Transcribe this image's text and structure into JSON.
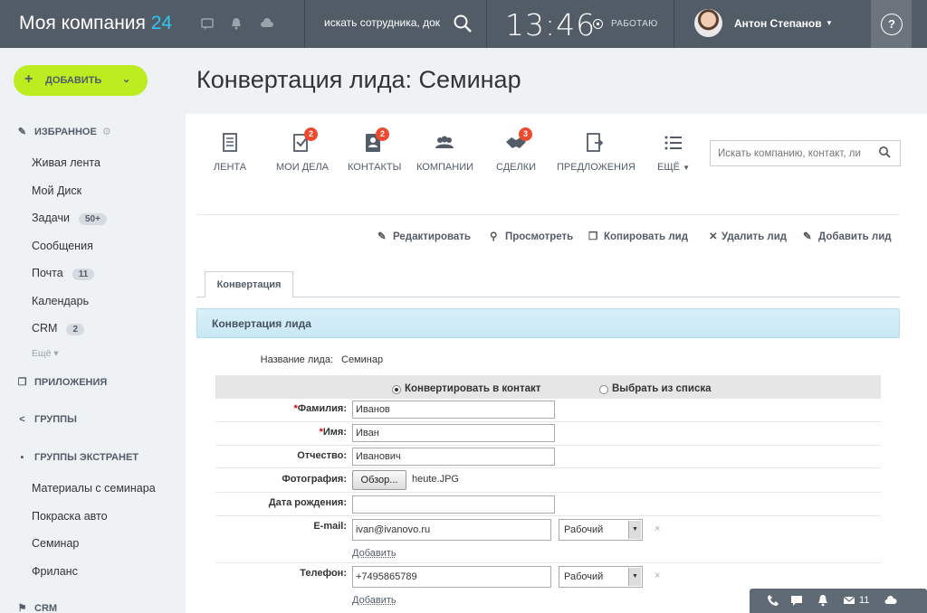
{
  "header": {
    "logo_text": "Моя компания",
    "logo_number": "24",
    "search_placeholder": "искать сотрудника, док",
    "clock": "13:46",
    "status": "РАБОТАЮ",
    "user_name": "Антон Степанов",
    "help": "?"
  },
  "sidebar": {
    "add_button": "ДОБАВИТЬ",
    "favorites_title": "ИЗБРАННОЕ",
    "favorites": [
      {
        "label": "Живая лента"
      },
      {
        "label": "Мой Диск"
      },
      {
        "label": "Задачи",
        "badge": "50+"
      },
      {
        "label": "Сообщения"
      },
      {
        "label": "Почта",
        "badge": "11"
      },
      {
        "label": "Календарь"
      },
      {
        "label": "CRM",
        "badge": "2"
      }
    ],
    "more": "Ещё",
    "apps_title": "ПРИЛОЖЕНИЯ",
    "groups_title": "ГРУППЫ",
    "extranet_title": "ГРУППЫ ЭКСТРАНЕТ",
    "extranet": [
      {
        "label": "Материалы с семинара"
      },
      {
        "label": "Покраска авто"
      },
      {
        "label": "Семинар"
      },
      {
        "label": "Фриланс"
      }
    ],
    "crm_title": "CRM"
  },
  "page_title": "Конвертация лида: Семинар",
  "crm_menu": {
    "items": [
      {
        "label": "ЛЕНТА",
        "icon": "feed-icon"
      },
      {
        "label": "МОИ ДЕЛА",
        "icon": "tasks-icon",
        "count": "2"
      },
      {
        "label": "КОНТАКТЫ",
        "icon": "contacts-icon",
        "count": "2"
      },
      {
        "label": "КОМПАНИИ",
        "icon": "companies-icon"
      },
      {
        "label": "СДЕЛКИ",
        "icon": "deals-icon",
        "count": "3"
      },
      {
        "label": "ПРЕДЛОЖЕНИЯ",
        "icon": "quotes-icon"
      },
      {
        "label": "ЕЩЁ",
        "icon": "more-icon"
      }
    ],
    "search_placeholder": "Искать компанию, контакт, ли"
  },
  "actions": {
    "edit": "Редактировать",
    "view": "Просмотреть",
    "copy": "Копировать лид",
    "delete": "Удалить лид",
    "add": "Добавить лид"
  },
  "tab": "Конвертация",
  "section_title": "Конвертация лида",
  "form": {
    "lead_name_label": "Название лида:",
    "lead_name_value": "Семинар",
    "option_convert": "Конвертировать в контакт",
    "option_select": "Выбрать из списка",
    "last_name_label": "Фамилия:",
    "last_name_value": "Иванов",
    "first_name_label": "Имя:",
    "first_name_value": "Иван",
    "middle_name_label": "Отчество:",
    "middle_name_value": "Иванович",
    "photo_label": "Фотография:",
    "browse": "Обзор...",
    "photo_file": "heute.JPG",
    "birthday_label": "Дата рождения:",
    "birthday_value": "",
    "email_label": "E-mail:",
    "email_value": "ivan@ivanovo.ru",
    "email_type": "Рабочий",
    "phone_label": "Телефон:",
    "phone_value": "+7495865789",
    "phone_type": "Рабочий",
    "add_link": "Добавить",
    "required_mark": "*",
    "delete_mark": "×"
  },
  "bottom_bar": {
    "mail_count": "11"
  },
  "colors": {
    "topbar": "#525c66",
    "accent_blue": "#2fc6f6",
    "add_button": "#bbed21",
    "counter": "#f04a2e",
    "section_bar": "#d9f0f9"
  }
}
